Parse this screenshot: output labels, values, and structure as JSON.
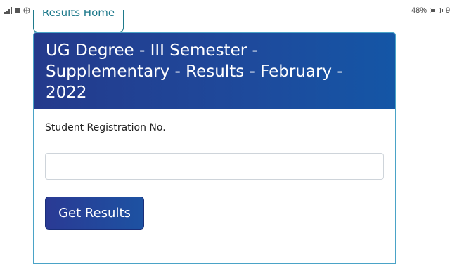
{
  "status_bar": {
    "battery_text": "48%",
    "trailing_char": "9"
  },
  "nav": {
    "home_label": "Results Home"
  },
  "card": {
    "title": "UG Degree - III Semester - Supplementary - Results - February - 2022",
    "reg_label": "Student Registration No.",
    "reg_value": "",
    "reg_placeholder": "",
    "submit_label": "Get Results"
  },
  "colors": {
    "header_gradient_start": "#243a8c",
    "header_gradient_end": "#1456a6",
    "home_button_text": "#1f7a8c",
    "card_border": "#4aa3c7"
  }
}
